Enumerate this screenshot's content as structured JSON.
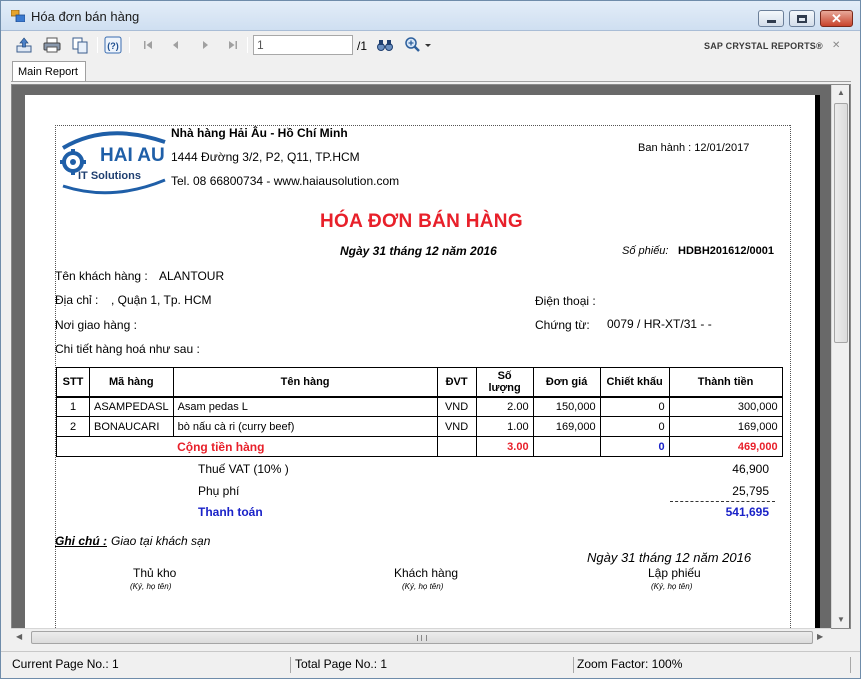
{
  "window": {
    "title": "Hóa đơn bán hàng"
  },
  "toolbar": {
    "page_value": "1",
    "page_total": "/1",
    "brand": "SAP CRYSTAL REPORTS®",
    "close_glyph": "✕",
    "icons": [
      "export-icon",
      "print-icon",
      "copy-icon",
      "help-icon",
      "first-page-icon",
      "prev-page-icon",
      "next-page-icon",
      "last-page-icon",
      "find-icon",
      "zoom-icon"
    ]
  },
  "tabs": [
    {
      "label": "Main Report"
    }
  ],
  "report": {
    "logo": {
      "line1": "HAI AU",
      "line2": "IT Solutions"
    },
    "company_name": "Nhà hàng Hải Âu - Hồ Chí Minh",
    "address": "1444 Đường 3/2, P2, Q11, TP.HCM",
    "tel": "Tel. 08 66800734 - www.haiausolution.com",
    "issued": "Ban hành : 12/01/2017",
    "title": "HÓA ĐƠN BÁN HÀNG",
    "date_line": "Ngày 31 tháng 12 năm 2016",
    "so_phieu_label": "Số phiếu:",
    "so_phieu_value": "HDBH201612/0001",
    "customer_label": "Tên khách hàng :",
    "customer_value": "ALANTOUR",
    "address_label": "Địa chỉ  :",
    "address_value": ", Quận 1, Tp. HCM",
    "phone_label": "Điện thoại :",
    "delivery_label": "Nơi giao hàng  :",
    "voucher_label": "Chứng từ:",
    "voucher_value": "0079 / HR-XT/31 -  -",
    "detail_label": "Chi tiết hàng hoá như sau :",
    "table": {
      "headers": [
        "STT",
        "Mã hàng",
        "Tên hàng",
        "ĐVT",
        "Số lượng",
        "Đơn giá",
        "Chiết khấu",
        "Thành  tiền"
      ],
      "rows": [
        [
          "1",
          "ASAMPEDASL",
          "Asam pedas L",
          "VND",
          "2.00",
          "150,000",
          "0",
          "300,000"
        ],
        [
          "2",
          "BONAUCARI",
          "bò nấu cà ri (curry beef)",
          "VND",
          "1.00",
          "169,000",
          "0",
          "169,000"
        ]
      ],
      "total": {
        "label": "Cộng tiền hàng",
        "qty": "3.00",
        "discount": "0",
        "amount": "469,000"
      }
    },
    "vat_label": "Thuế VAT (10% )",
    "vat_value": "46,900",
    "fee_label": "Phụ phí",
    "fee_value": "25,795",
    "payment_label": "Thanh toán",
    "payment_value": "541,695",
    "note_label": "Ghi chú :",
    "note_value": "Giao tại khách sạn",
    "sign_date": "Ngày 31 tháng 12 năm 2016",
    "signers": [
      {
        "title": "Thủ kho",
        "sub": "(Ký, họ tên)"
      },
      {
        "title": "Khách hàng",
        "sub": "(Ký, họ tên)"
      },
      {
        "title": "Lập phiếu",
        "sub": "(Ký, họ tên)"
      }
    ]
  },
  "status": {
    "current_page": "Current Page No.: 1",
    "total_page": "Total Page No.: 1",
    "zoom": "Zoom Factor: 100%"
  },
  "colors": {
    "title_red": "#e8202a",
    "payment_blue": "#1a22c8",
    "logo_blue": "#1f5fa8"
  }
}
